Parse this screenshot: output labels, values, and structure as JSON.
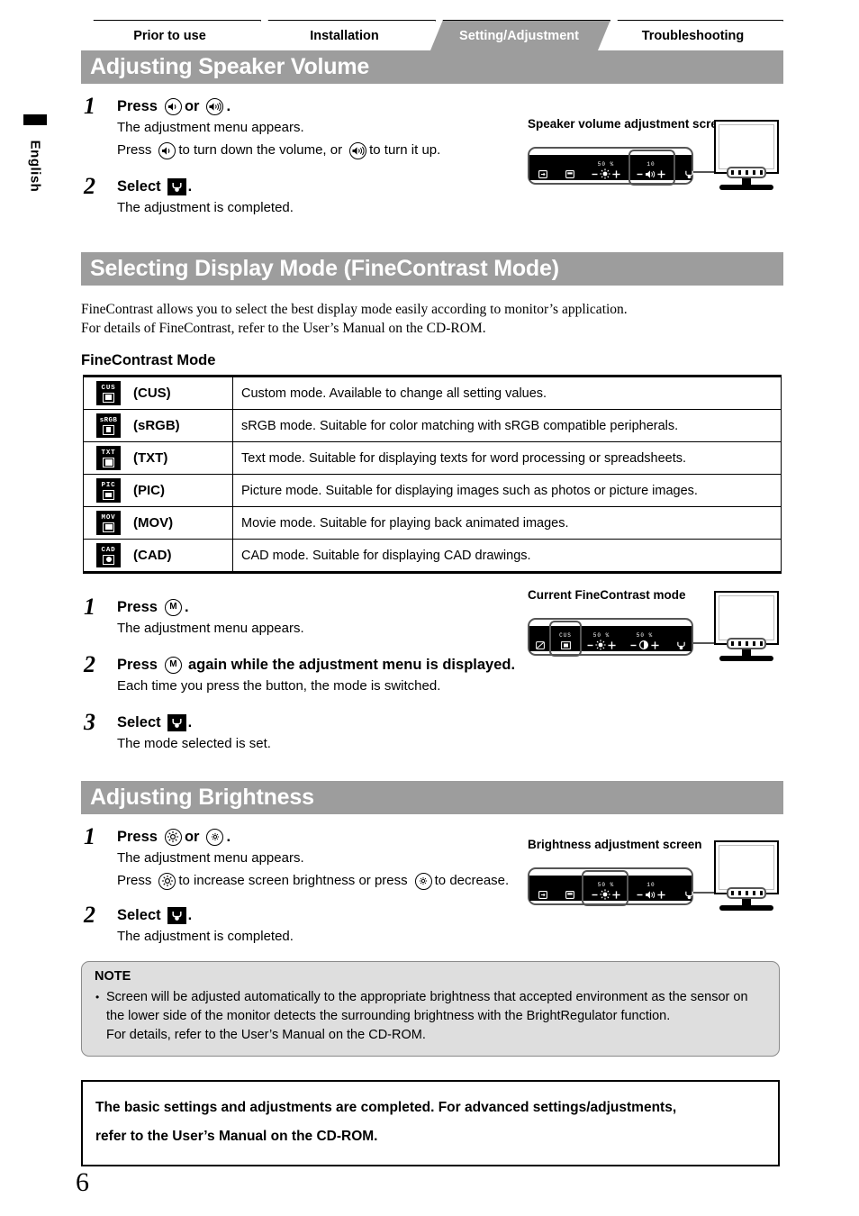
{
  "language_tab": {
    "label": "English"
  },
  "tabs": [
    {
      "label": "Prior to use",
      "active": false
    },
    {
      "label": "Installation",
      "active": false
    },
    {
      "label": "Setting/Adjustment",
      "active": true
    },
    {
      "label": "Troubleshooting",
      "active": false
    }
  ],
  "colors": {
    "banner_gray": "#9d9d9d",
    "active_tab_gray": "#9d9d9d",
    "note_gray": "#dedede",
    "osd_black": "#000000",
    "outline_gray": "#555555"
  },
  "sections": {
    "speaker": {
      "banner": "Adjusting Speaker Volume",
      "steps": [
        {
          "num": "1",
          "head_before": "Press",
          "head_or": "or",
          "head_after": ".",
          "icon_left": "volume-down-icon",
          "icon_right": "volume-up-icon",
          "sub1": "The adjustment menu appears.",
          "sub2_a": "Press",
          "sub2_b": "to turn down the volume, or",
          "sub2_c": "to turn it up."
        },
        {
          "num": "2",
          "head_before": "Select",
          "head_after": ".",
          "icon": "enter-icon",
          "sub1": "The adjustment is completed."
        }
      ],
      "illustration": {
        "caption": "Speaker volume adjustment screen",
        "osd_cells": [
          {
            "icon": "input-signal-icon",
            "value": ""
          },
          {
            "icon": "screen-adjust-icon",
            "value": ""
          },
          {
            "icon": "brightness-icon",
            "value": "50 %",
            "minus_plus": true
          },
          {
            "icon": "volume-icon",
            "value": "10",
            "minus_plus": true,
            "selected": true
          },
          {
            "icon": "enter-icon",
            "value": ""
          }
        ]
      }
    },
    "finecontrast": {
      "banner": "Selecting Display Mode (FineContrast Mode)",
      "intro_line1": "FineContrast allows you to select the best display mode easily according to monitor’s application.",
      "intro_line2": "For details of FineContrast, refer to the User’s Manual on the CD-ROM.",
      "subhead": "FineContrast Mode",
      "table_rows": [
        {
          "icon_text": "CUS",
          "label": "(CUS)",
          "desc": "Custom mode. Available to change all setting values."
        },
        {
          "icon_text": "sRGB",
          "label": "(sRGB)",
          "desc": "sRGB mode. Suitable for color matching with sRGB compatible peripherals."
        },
        {
          "icon_text": "TXT",
          "label": "(TXT)",
          "desc": "Text mode. Suitable for displaying texts for word processing or spreadsheets."
        },
        {
          "icon_text": "PIC",
          "label": "(PIC)",
          "desc": "Picture mode. Suitable for displaying images such as photos or picture images."
        },
        {
          "icon_text": "MOV",
          "label": "(MOV)",
          "desc": "Movie mode. Suitable for playing back animated images."
        },
        {
          "icon_text": "CAD",
          "label": "(CAD)",
          "desc": "CAD mode. Suitable for displaying CAD drawings."
        }
      ],
      "steps": [
        {
          "num": "1",
          "head_before": "Press",
          "head_after": ".",
          "icon": "mode-button-icon",
          "icon_letter": "M",
          "sub1": "The adjustment menu appears."
        },
        {
          "num": "2",
          "head_before": "Press",
          "head_after": "again while the adjustment menu is displayed.",
          "icon": "mode-button-icon",
          "icon_letter": "M",
          "sub1": "Each time you press the button, the mode is switched."
        },
        {
          "num": "3",
          "head_before": "Select",
          "head_after": ".",
          "icon": "enter-icon",
          "sub1": "The mode selected is set."
        }
      ],
      "illustration": {
        "caption": "Current FineContrast mode",
        "osd_cells": [
          {
            "icon": "finecontrast-icon",
            "value": ""
          },
          {
            "icon": "mode-cus-icon",
            "value": "CUS",
            "selected": true
          },
          {
            "icon": "brightness-icon",
            "value": "50 %",
            "minus_plus": true
          },
          {
            "icon": "contrast-icon",
            "value": "50 %",
            "minus_plus": true
          },
          {
            "icon": "enter-icon",
            "value": ""
          }
        ]
      }
    },
    "brightness": {
      "banner": "Adjusting Brightness",
      "steps": [
        {
          "num": "1",
          "head_before": "Press",
          "head_or": "or",
          "head_after": ".",
          "icon_left": "brightness-up-icon",
          "icon_right": "brightness-down-icon",
          "sub1": "The adjustment menu appears.",
          "sub2_a": "Press",
          "sub2_b": "to increase screen brightness or press",
          "sub2_c": "to decrease."
        },
        {
          "num": "2",
          "head_before": "Select",
          "head_after": ".",
          "icon": "enter-icon",
          "sub1": "The adjustment is completed."
        }
      ],
      "illustration": {
        "caption": "Brightness adjustment screen",
        "osd_cells": [
          {
            "icon": "input-signal-icon",
            "value": ""
          },
          {
            "icon": "screen-adjust-icon",
            "value": ""
          },
          {
            "icon": "brightness-icon",
            "value": "50 %",
            "minus_plus": true,
            "selected": true
          },
          {
            "icon": "volume-icon",
            "value": "10",
            "minus_plus": true
          },
          {
            "icon": "enter-icon",
            "value": ""
          }
        ]
      }
    }
  },
  "note": {
    "title": "NOTE",
    "body_line1": "Screen will be adjusted automatically to the appropriate brightness that accepted environment as the sensor on the lower side of the monitor detects the surrounding brightness with the BrightRegulator function.",
    "body_line2": "For details, refer to the User’s Manual on the CD-ROM."
  },
  "final_box": {
    "line1": "The basic settings and adjustments are completed. For advanced settings/adjustments,",
    "line2": "refer to the User’s Manual on the CD-ROM."
  },
  "page_number": "6"
}
